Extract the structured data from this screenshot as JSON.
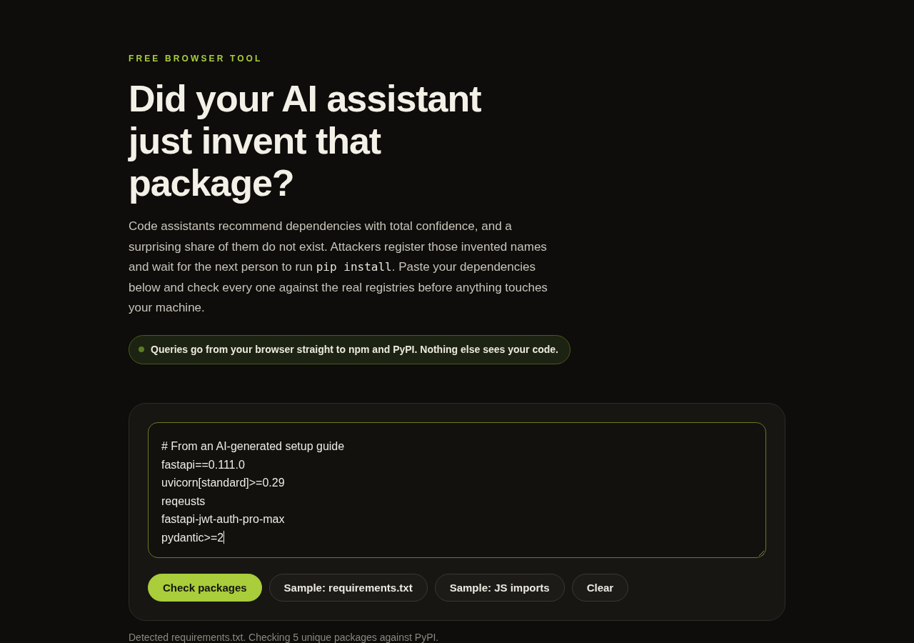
{
  "hero": {
    "eyebrow": "FREE BROWSER TOOL",
    "title": "Did your AI assistant just invent that package?",
    "intro": [
      {
        "kind": "text",
        "text": "Code assistants recommend dependencies with total confidence, and a surprising share of them do not exist. Attackers register those invented names and wait for the next person to run "
      },
      {
        "kind": "code",
        "text": "pip install"
      },
      {
        "kind": "text",
        "text": ". Paste your dependencies below and check every one against the real registries before anything touches your machine."
      }
    ],
    "privacy_note": "Queries go from your browser straight to npm and PyPI. Nothing else sees your code."
  },
  "checker": {
    "editor": {
      "value": "# From an AI-generated setup guide\nfastapi==0.111.0\nuvicorn[standard]>=0.29\nreqeusts\nfastapi-jwt-auth-pro-max\npydantic>=2",
      "focused": true
    },
    "buttons": [
      {
        "label": "Check packages",
        "kind": "primary"
      },
      {
        "label": "Sample: requirements.txt",
        "kind": "secondary"
      },
      {
        "label": "Sample: JS imports",
        "kind": "secondary"
      },
      {
        "label": "Clear",
        "kind": "secondary"
      }
    ]
  },
  "status": "Detected requirements.txt. Checking 5 unique packages against PyPI."
}
